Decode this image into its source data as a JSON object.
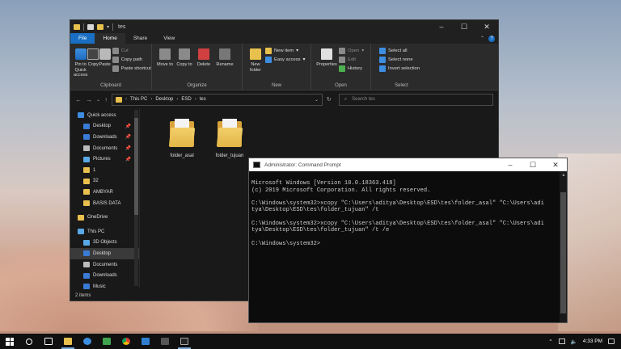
{
  "explorer": {
    "title": "tes",
    "tabs": [
      "File",
      "Home",
      "Share",
      "View"
    ],
    "ribbon": {
      "clipboard": {
        "name": "Clipboard",
        "pin": "Pin to Quick access",
        "copy": "Copy",
        "paste": "Paste",
        "cut": "Cut",
        "copy_path": "Copy path",
        "paste_shortcut": "Paste shortcut"
      },
      "organize": {
        "name": "Organize",
        "move_to": "Move to",
        "copy_to": "Copy to",
        "delete": "Delete",
        "rename": "Rename"
      },
      "new": {
        "name": "New",
        "new_folder": "New folder",
        "new_item": "New item",
        "easy_access": "Easy access"
      },
      "open": {
        "name": "Open",
        "properties": "Properties",
        "open": "Open",
        "edit": "Edit",
        "history": "History"
      },
      "select": {
        "name": "Select",
        "select_all": "Select all",
        "select_none": "Select none",
        "invert": "Invert selection"
      }
    },
    "address": {
      "crumbs": [
        "This PC",
        "Desktop",
        "ESD",
        "tes"
      ],
      "search_placeholder": "Search tes"
    },
    "nav": {
      "quick_access": "Quick access",
      "desktop": "Desktop",
      "downloads": "Downloads",
      "documents": "Documents",
      "pictures": "Pictures",
      "f1": "1",
      "f32": "32",
      "ambyar": "AMBYAR",
      "basis_data": "BASIS DATA",
      "onedrive": "OneDrive",
      "this_pc": "This PC",
      "objects3d": "3D Objects",
      "desktop2": "Desktop",
      "documents2": "Documents",
      "downloads2": "Downloads",
      "music": "Music"
    },
    "files": [
      "folder_asal",
      "folder_tujuan"
    ],
    "status": "2 items"
  },
  "cmd": {
    "title": "Administrator: Command Prompt",
    "lines": [
      "Microsoft Windows [Version 10.0.18363.418]",
      "(c) 2019 Microsoft Corporation. All rights reserved.",
      "",
      "C:\\Windows\\system32>xcopy \"C:\\Users\\aditya\\Desktop\\ESD\\tes\\folder_asal\" \"C:\\Users\\adi",
      "tya\\Desktop\\ESD\\tes\\folder_tujuan\" /t",
      "",
      "C:\\Windows\\system32>xcopy \"C:\\Users\\aditya\\Desktop\\ESD\\tes\\folder_asal\" \"C:\\Users\\adi",
      "tya\\Desktop\\ESD\\tes\\folder_tujuan\" /t /e",
      "",
      "C:\\Windows\\system32>"
    ]
  },
  "taskbar": {
    "time": "4:33 PM"
  }
}
